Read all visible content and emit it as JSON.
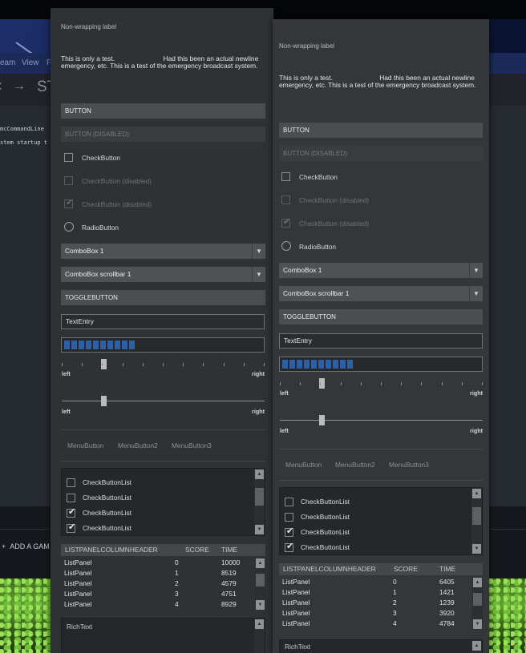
{
  "background": {
    "menu": [
      "eam",
      "View",
      "F"
    ],
    "nav_title": "ST",
    "console_lines": [
      "mcCommandLine",
      "stem startup t"
    ],
    "add_game": "ADD A GAM"
  },
  "panel_left": {
    "nonwrap_label": "Non-wrapping label",
    "paragraph": "This is only a test.                          Had this been an actual newline\nemergency, etc. This is a test of the emergency broadcast system.",
    "button": "BUTTON",
    "button_disabled": "BUTTON (DISABLED)",
    "checkbutton": "CheckButton",
    "checkbutton_disabled": "CheckButton (disabled)",
    "checkbutton_disabled_checked": "CheckButton (disabled)",
    "radiobutton": "RadioButton",
    "combobox1": "ComboBox 1",
    "combobox_scrollbar": "ComboBox scrollbar 1",
    "togglebutton": "TOGGLEBUTTON",
    "textentry": "TextEntry",
    "progress_fraction": 0.36,
    "slider_left_label": "left",
    "slider_right_label": "right",
    "slider1_value": 0.2,
    "slider2_value": 0.2,
    "menubuttons": [
      "MenuButton",
      "MenuButton2",
      "MenuButton3"
    ],
    "checklist": [
      {
        "label": "CheckButtonList",
        "checked": false
      },
      {
        "label": "CheckButtonList",
        "checked": false
      },
      {
        "label": "CheckButtonList",
        "checked": true
      },
      {
        "label": "CheckButtonList",
        "checked": true
      }
    ],
    "listpanel_headers": [
      "LISTPANELCOLUMNHEADER",
      "SCORE",
      "TIME"
    ],
    "listpanel_rows": [
      [
        "ListPanel",
        "0",
        "10000"
      ],
      [
        "ListPanel",
        "1",
        "8519"
      ],
      [
        "ListPanel",
        "2",
        "4579"
      ],
      [
        "ListPanel",
        "3",
        "4751"
      ],
      [
        "ListPanel",
        "4",
        "8929"
      ]
    ],
    "richtext": "RichText"
  },
  "panel_right": {
    "nonwrap_label": "Non-wrapping label",
    "paragraph": "This is only a test.                         Had this been an actual newline\nemergency, etc. This is a test of the emergency broadcast system.",
    "button": "BUTTON",
    "button_disabled": "BUTTON (DISABLED)",
    "checkbutton": "CheckButton",
    "checkbutton_disabled": "CheckButton (disabled)",
    "checkbutton_disabled_checked": "CheckButton (disabled)",
    "radiobutton": "RadioButton",
    "combobox1": "ComboBox 1",
    "combobox_scrollbar": "ComboBox scrollbar 1",
    "togglebutton": "TOGGLEBUTTON",
    "textentry": "TextEntry",
    "progress_fraction": 0.36,
    "slider_left_label": "left",
    "slider_right_label": "right",
    "slider1_value": 0.2,
    "slider2_value": 0.2,
    "menubuttons": [
      "MenuButton",
      "MenuButton2",
      "MenuButton3"
    ],
    "checklist": [
      {
        "label": "CheckButtonList",
        "checked": false
      },
      {
        "label": "CheckButtonList",
        "checked": false
      },
      {
        "label": "CheckButtonList",
        "checked": true
      },
      {
        "label": "CheckButtonList",
        "checked": true
      }
    ],
    "listpanel_headers": [
      "LISTPANELCOLUMNHEADER",
      "SCORE",
      "TIME"
    ],
    "listpanel_rows": [
      [
        "ListPanel",
        "0",
        "6405"
      ],
      [
        "ListPanel",
        "1",
        "1421"
      ],
      [
        "ListPanel",
        "2",
        "1239"
      ],
      [
        "ListPanel",
        "3",
        "3920"
      ],
      [
        "ListPanel",
        "4",
        "4784"
      ]
    ],
    "richtext": "RichText"
  },
  "icons": {
    "check": "check-icon",
    "combo_arrow": "chevron-down-icon",
    "scroll_up": "scroll-up-icon",
    "scroll_down": "scroll-down-icon"
  },
  "colors": {
    "progress_fill": "#2d5ea8",
    "panel_bg": "#2f3133",
    "button_bg": "#4b4d50"
  }
}
